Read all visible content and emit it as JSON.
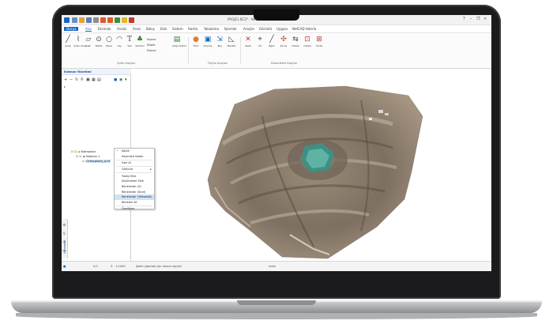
{
  "window": {
    "title": "PROJE1.BCZ* - Netcad 8.5 for Windows",
    "controls": [
      "?",
      "–",
      "❐",
      "✕"
    ]
  },
  "tabs": [
    "Dosya",
    "Ana",
    "Ekranda",
    "Analiz",
    "Arazi",
    "Bakış",
    "Ekle",
    "Sistem",
    "Harita",
    "Yakalama",
    "İşlemler",
    "Araçlar",
    "Görüntü",
    "Uygula",
    "NetCAD Hatırla"
  ],
  "ribbon": {
    "buttons": [
      {
        "label": "Çizgi",
        "icon": "line-icon"
      },
      {
        "label": "Çoklu Çizgi",
        "icon": "polyline-icon"
      },
      {
        "label": "Alan",
        "icon": "area-icon"
      },
      {
        "label": "Nokta",
        "icon": "point-icon"
      },
      {
        "label": "Daire",
        "icon": "circle-icon"
      },
      {
        "label": "Yay",
        "icon": "arc-icon"
      },
      {
        "label": "Yazı",
        "icon": "text-icon"
      },
      {
        "label": "Sembol",
        "icon": "tree-icon"
      },
      {
        "label": "Çizgi Üretici",
        "icon": "lines-icon"
      },
      {
        "label": "Ölçü",
        "icon": "measure-icon"
      },
      {
        "label": "Kırpma",
        "icon": "trim-icon"
      },
      {
        "label": "Taşı",
        "icon": "move-icon"
      },
      {
        "label": "Mesafe",
        "icon": "distance-icon"
      },
      {
        "label": "Kesit",
        "icon": "section-icon"
      },
      {
        "label": "Sil",
        "icon": "delete-icon"
      },
      {
        "label": "Eğim",
        "icon": "slope-icon"
      },
      {
        "label": "Kırma",
        "icon": "break-icon"
      },
      {
        "label": "Hizala",
        "icon": "align-icon"
      },
      {
        "label": "Ortala",
        "icon": "center-icon"
      },
      {
        "label": "Yenile",
        "icon": "refresh-icon"
      }
    ],
    "small_items": [
      "Kırpma",
      "Düzelt",
      "Kılavuz",
      "Kapat"
    ],
    "groups": [
      "Çizim Araçları",
      "Ölçüm Araçları",
      "Düzenleme Araçları"
    ]
  },
  "left_panel": {
    "title": "Katman Yönetimi",
    "tree": [
      {
        "label": "Katmanlar",
        "level": 0
      },
      {
        "label": "Katman 1",
        "level": 1
      },
      {
        "label": "Orthophoto_A.tif",
        "level": 2
      }
    ],
    "vertical_tab": "Katmanlar"
  },
  "context_menu": {
    "items": [
      {
        "label": "Kaldır",
        "selected": false,
        "submenu": false
      },
      {
        "label": "Seçimleri Kaldır",
        "selected": false,
        "submenu": false
      },
      {
        "label": "Geri Al",
        "selected": false,
        "submenu": false
      },
      {
        "label": "Görünür",
        "selected": false,
        "submenu": true
      },
      {
        "label": "Yüzey Ekle",
        "selected": false,
        "submenu": false
      },
      {
        "label": "Seçilmeleri Ekle",
        "selected": false,
        "submenu": false
      },
      {
        "label": "Renklendir (Z)",
        "selected": false,
        "submenu": false
      },
      {
        "label": "Renklendir (Sınıf)",
        "selected": false,
        "submenu": false
      },
      {
        "label": "Renklendir (Yükseklik)",
        "selected": true,
        "submenu": false
      },
      {
        "label": "Renkleri Sil",
        "selected": false,
        "submenu": false
      },
      {
        "label": "Özellikler",
        "selected": false,
        "submenu": false
      }
    ]
  },
  "status": {
    "coords": "0,0",
    "zoom": "1:1000",
    "message": "İşlem yapmak için nesne seçiniz",
    "mode": "RUNNING",
    "right": "main"
  },
  "colors": {
    "accent": "#1565c0",
    "selection": "#cfe3f7",
    "panel_title": "#1a4b8c"
  }
}
